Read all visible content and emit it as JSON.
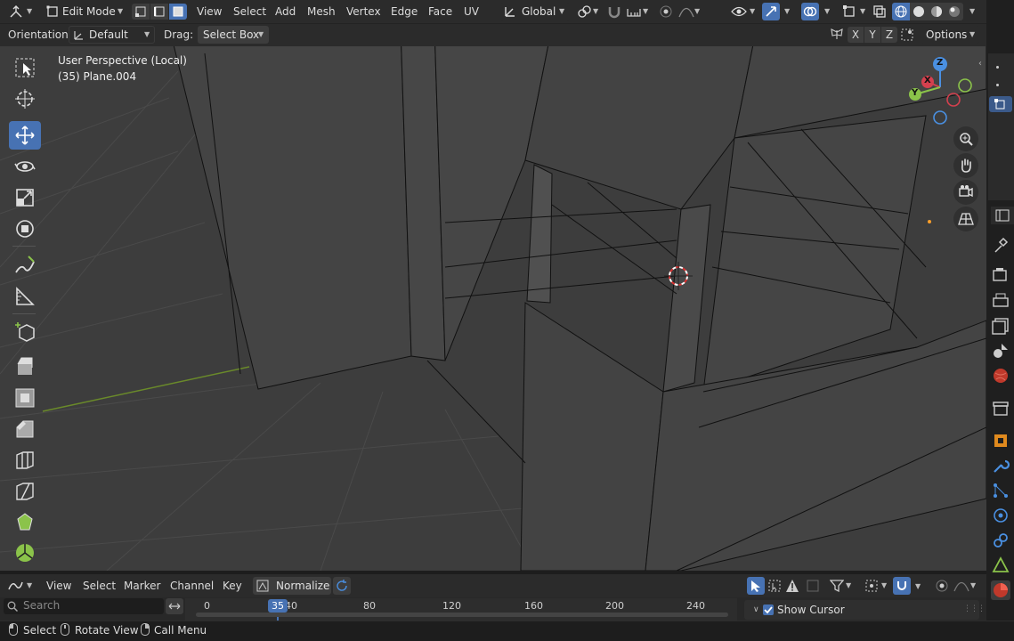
{
  "header": {
    "mode_label": "Edit Mode",
    "menus": [
      "View",
      "Select",
      "Add",
      "Mesh",
      "Vertex",
      "Edge",
      "Face",
      "UV"
    ],
    "transform_orientation": "Global"
  },
  "tool_settings": {
    "orientation_label": "Orientation:",
    "orientation_value": "Default",
    "drag_label": "Drag:",
    "drag_value": "Select Box",
    "axes": [
      "X",
      "Y",
      "Z"
    ],
    "options_label": "Options"
  },
  "viewport": {
    "view_name": "User Perspective (Local)",
    "object_info": "(35) Plane.004",
    "gizmo_axes": {
      "z": "Z",
      "y": "Y",
      "x": "X"
    }
  },
  "timeline": {
    "menus": [
      "View",
      "Select",
      "Marker",
      "Channel",
      "Key"
    ],
    "normalize_label": "Normalize",
    "search_placeholder": "Search",
    "ticks": [
      "0",
      "40",
      "80",
      "120",
      "160",
      "200",
      "240"
    ],
    "current_frame": "35",
    "show_cursor_label": "Show Cursor",
    "show_cursor_checked": true
  },
  "statusbar": {
    "items": [
      "Select",
      "Rotate View",
      "Call Menu"
    ]
  },
  "colors": {
    "accent": "#4772b3",
    "x_axis": "#d4404e",
    "y_axis": "#8bc34a",
    "z_axis": "#4a90e2"
  }
}
